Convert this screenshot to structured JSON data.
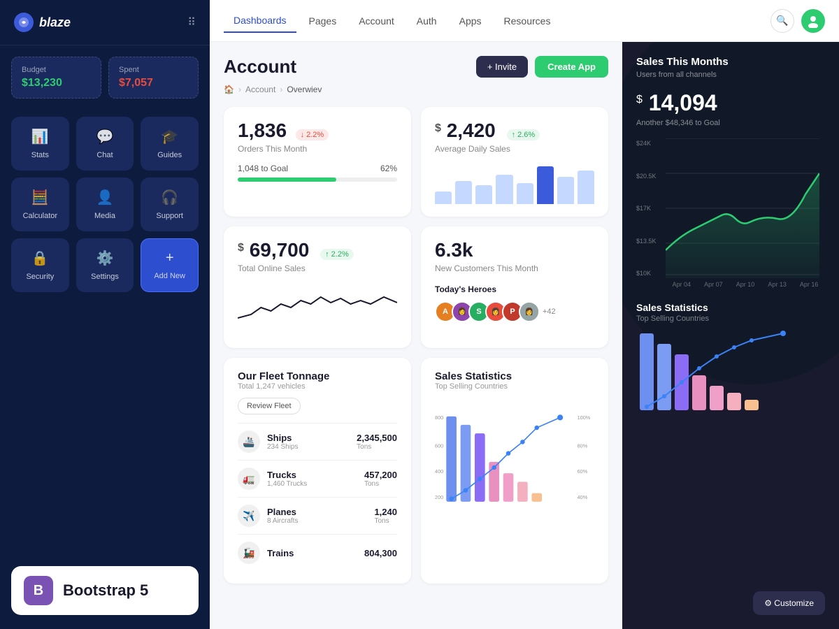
{
  "sidebar": {
    "logo_text": "blaze",
    "budget": {
      "label": "Budget",
      "value": "$13,230"
    },
    "spent": {
      "label": "Spent",
      "value": "$7,057"
    },
    "menu_items": [
      {
        "label": "Stats",
        "icon": "📊",
        "active": false
      },
      {
        "label": "Chat",
        "icon": "💬",
        "active": false
      },
      {
        "label": "Guides",
        "icon": "🎓",
        "active": false
      },
      {
        "label": "Calculator",
        "icon": "🧮",
        "active": false
      },
      {
        "label": "Media",
        "icon": "👤",
        "active": false
      },
      {
        "label": "Support",
        "icon": "🎧",
        "active": false
      },
      {
        "label": "Security",
        "icon": "🔒",
        "active": false
      },
      {
        "label": "Settings",
        "icon": "⚙️",
        "active": false
      },
      {
        "label": "Add New",
        "icon": "+",
        "active": true
      }
    ],
    "bootstrap_text": "Bootstrap 5",
    "bootstrap_icon": "B"
  },
  "topnav": {
    "items": [
      {
        "label": "Dashboards",
        "active": true
      },
      {
        "label": "Pages",
        "active": false
      },
      {
        "label": "Account",
        "active": false
      },
      {
        "label": "Auth",
        "active": false
      },
      {
        "label": "Apps",
        "active": false
      },
      {
        "label": "Resources",
        "active": false
      }
    ]
  },
  "page": {
    "title": "Account",
    "breadcrumb": [
      "Account",
      "Overwiev"
    ],
    "invite_label": "+ Invite",
    "create_label": "Create App"
  },
  "stats": {
    "orders": {
      "number": "1,836",
      "badge": "↓ 2.2%",
      "badge_type": "red",
      "label": "Orders This Month",
      "progress_label": "1,048 to Goal",
      "progress_pct": "62%",
      "progress_val": 62
    },
    "daily_sales": {
      "prefix": "$",
      "number": "2,420",
      "badge": "↑ 2.6%",
      "badge_type": "green",
      "label": "Average Daily Sales"
    },
    "online_sales": {
      "prefix": "$",
      "number": "69,700",
      "badge": "↑ 2.2%",
      "badge_type": "green",
      "label": "Total Online Sales"
    },
    "new_customers": {
      "number": "6.3k",
      "label": "New Customers This Month",
      "today_heroes_label": "Today's Heroes",
      "heroes_extra": "+42"
    }
  },
  "right_panel": {
    "title": "Sales This Months",
    "subtitle": "Users from all channels",
    "big_number": "14,094",
    "goal_text": "Another $48,346 to Goal",
    "y_labels": [
      "$24K",
      "$20.5K",
      "$17K",
      "$13.5K",
      "$10K"
    ],
    "x_labels": [
      "Apr 04",
      "Apr 07",
      "Apr 10",
      "Apr 13",
      "Apr 16"
    ]
  },
  "fleet": {
    "title": "Our Fleet Tonnage",
    "subtitle": "Total 1,247 vehicles",
    "btn": "Review Fleet",
    "items": [
      {
        "icon": "🚢",
        "name": "Ships",
        "sub": "234 Ships",
        "value": "2,345,500",
        "unit": "Tons"
      },
      {
        "icon": "🚛",
        "name": "Trucks",
        "sub": "1,460 Trucks",
        "value": "457,200",
        "unit": "Tons"
      },
      {
        "icon": "✈️",
        "name": "Planes",
        "sub": "8 Aircrafts",
        "value": "1,240",
        "unit": "Tons"
      },
      {
        "icon": "🚂",
        "name": "Trains",
        "sub": "",
        "value": "804,300",
        "unit": ""
      }
    ]
  },
  "sales_stats": {
    "title": "Sales Statistics",
    "subtitle": "Top Selling Countries"
  },
  "customize_label": "⚙ Customize"
}
